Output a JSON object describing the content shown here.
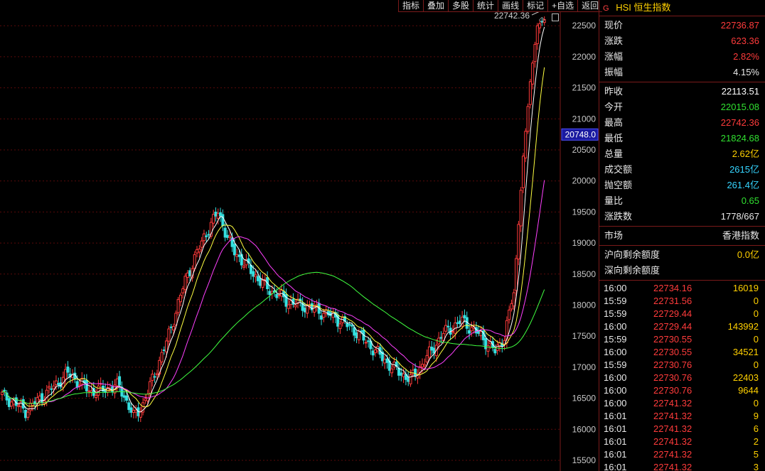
{
  "toolbar": {
    "items": [
      "指标",
      "叠加",
      "多股",
      "统计",
      "画线",
      "标记",
      "+自选",
      "返回"
    ]
  },
  "chart": {
    "peak_label": "22742.36",
    "current_price_tag": "20748.0",
    "y_ticks": [
      "22500",
      "22000",
      "21500",
      "21000",
      "20500",
      "20000",
      "19500",
      "19000",
      "18500",
      "18000",
      "17500",
      "17000",
      "16500",
      "16000",
      "15500"
    ],
    "colors": {
      "up": "#ff3b3b",
      "down": "#35e0e0",
      "ma5": "#ffffff",
      "ma10": "#ffff40",
      "ma20": "#ff40ff",
      "ma60": "#40ff40",
      "grid": "#5a0a0a",
      "price_tag_bg": "#1a1aa0"
    }
  },
  "chart_data": {
    "type": "candlestick",
    "ylim": [
      15500,
      22800
    ],
    "ma_series": [
      "MA5",
      "MA10",
      "MA20",
      "MA60"
    ]
  },
  "panel": {
    "marker": "G",
    "title": "HSI 恒生指数",
    "quote": [
      {
        "label": "现价",
        "value": "22736.87",
        "color": "#ff3b3b"
      },
      {
        "label": "涨跌",
        "value": "623.36",
        "color": "#ff3b3b"
      },
      {
        "label": "涨幅",
        "value": "2.82%",
        "color": "#ff3b3b"
      },
      {
        "label": "振幅",
        "value": "4.15%",
        "color": "#e8e8e8"
      }
    ],
    "stats": [
      {
        "label": "昨收",
        "value": "22113.51",
        "color": "#ffffff"
      },
      {
        "label": "今开",
        "value": "22015.08",
        "color": "#30e030"
      },
      {
        "label": "最高",
        "value": "22742.36",
        "color": "#ff3b3b"
      },
      {
        "label": "最低",
        "value": "21824.68",
        "color": "#30e030"
      },
      {
        "label": "总量",
        "value": "2.62亿",
        "color": "#ffd000"
      },
      {
        "label": "成交额",
        "value": "2615亿",
        "color": "#35d5ff"
      },
      {
        "label": "抛空额",
        "value": "261.4亿",
        "color": "#35d5ff"
      },
      {
        "label": "量比",
        "value": "0.65",
        "color": "#30e030"
      },
      {
        "label": "涨跌数",
        "value": "1778/667",
        "color": "#e8e8e8"
      }
    ],
    "market": {
      "label": "市场",
      "value": "香港指数",
      "color": "#e8e8e8"
    },
    "quota": [
      {
        "label": "沪向剩余额度",
        "value": "0.0亿",
        "color": "#ffd000"
      },
      {
        "label": "深向剩余额度",
        "value": "",
        "color": "#ffd000"
      }
    ],
    "ticks": [
      {
        "time": "16:00",
        "price": "22734.16",
        "vol": "16019"
      },
      {
        "time": "15:59",
        "price": "22731.56",
        "vol": "0"
      },
      {
        "time": "15:59",
        "price": "22729.44",
        "vol": "0"
      },
      {
        "time": "16:00",
        "price": "22729.44",
        "vol": "143992"
      },
      {
        "time": "15:59",
        "price": "22730.55",
        "vol": "0"
      },
      {
        "time": "16:00",
        "price": "22730.55",
        "vol": "34521"
      },
      {
        "time": "15:59",
        "price": "22730.76",
        "vol": "0"
      },
      {
        "time": "16:00",
        "price": "22730.76",
        "vol": "22403"
      },
      {
        "time": "16:00",
        "price": "22730.76",
        "vol": "9644"
      },
      {
        "time": "16:00",
        "price": "22741.32",
        "vol": "0"
      },
      {
        "time": "16:01",
        "price": "22741.32",
        "vol": "9"
      },
      {
        "time": "16:01",
        "price": "22741.32",
        "vol": "6"
      },
      {
        "time": "16:01",
        "price": "22741.32",
        "vol": "2"
      },
      {
        "time": "16:01",
        "price": "22741.32",
        "vol": "5"
      },
      {
        "time": "16:01",
        "price": "22741.32",
        "vol": "3"
      }
    ]
  }
}
